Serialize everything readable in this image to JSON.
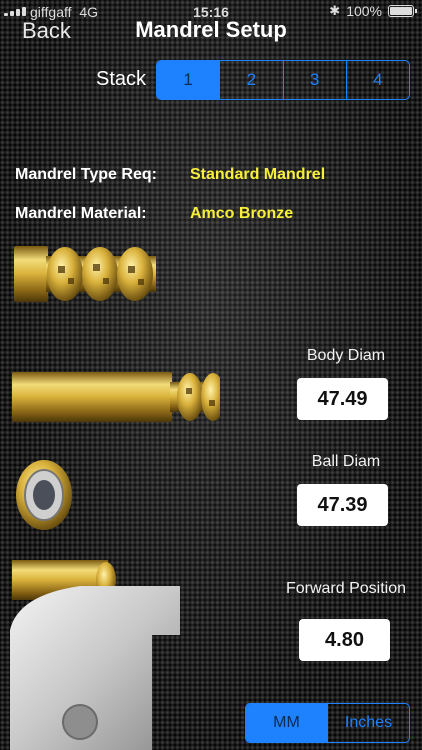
{
  "status_bar": {
    "carrier": "giffgaff",
    "network": "4G",
    "time": "15:16",
    "battery": "100%"
  },
  "nav": {
    "back_label": "Back",
    "title": "Mandrel Setup"
  },
  "stack": {
    "label": "Stack",
    "options": [
      "1",
      "2",
      "3",
      "4"
    ],
    "selected_index": 0
  },
  "info": {
    "type_label": "Mandrel Type Req:",
    "type_value": "Standard Mandrel",
    "material_label": "Mandrel Material:",
    "material_value": "Amco Bronze"
  },
  "measurements": {
    "body_diam_label": "Body Diam",
    "body_diam_value": "47.49",
    "ball_diam_label": "Ball Diam",
    "ball_diam_value": "47.39",
    "forward_position_label": "Forward Position",
    "forward_position_value": "4.80"
  },
  "units": {
    "options": [
      "MM",
      "Inches"
    ],
    "selected_index": 0
  },
  "colors": {
    "accent": "#1e82ff",
    "value_yellow": "#f7ef3a",
    "gold": "#d8b13a"
  }
}
